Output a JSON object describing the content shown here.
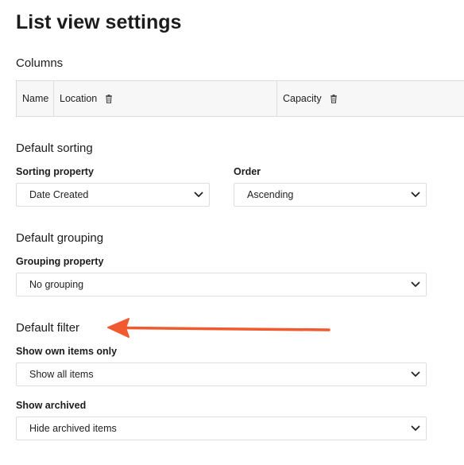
{
  "page": {
    "title": "List view settings"
  },
  "columns": {
    "heading": "Columns",
    "items": [
      {
        "label": "Name",
        "deletable": false
      },
      {
        "label": "Location",
        "deletable": true
      },
      {
        "label": "Capacity",
        "deletable": true
      }
    ]
  },
  "sorting": {
    "heading": "Default sorting",
    "property_label": "Sorting property",
    "property_value": "Date Created",
    "order_label": "Order",
    "order_value": "Ascending"
  },
  "grouping": {
    "heading": "Default grouping",
    "property_label": "Grouping property",
    "property_value": "No grouping"
  },
  "filter": {
    "heading": "Default filter",
    "own_items_label": "Show own items only",
    "own_items_value": "Show all items",
    "archived_label": "Show archived",
    "archived_value": "Hide archived items"
  },
  "colors": {
    "arrow": "#f05a2e"
  }
}
